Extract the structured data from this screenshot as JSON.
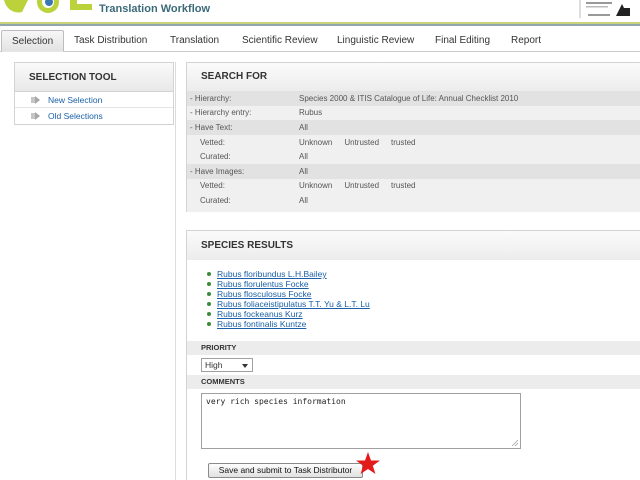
{
  "header": {
    "app_title": "Translation Workflow",
    "logo_icon": "col-logo-icon",
    "partner_logo_icon": "bibliotheca-alexandrina-logo-icon"
  },
  "tabs": [
    {
      "label": "Selection",
      "active": true
    },
    {
      "label": "Task Distribution",
      "active": false
    },
    {
      "label": "Translation",
      "active": false
    },
    {
      "label": "Scientific Review",
      "active": false
    },
    {
      "label": "Linguistic Review",
      "active": false
    },
    {
      "label": "Final Editing",
      "active": false
    },
    {
      "label": "Report",
      "active": false
    }
  ],
  "selection_tool": {
    "title": "SELECTION TOOL",
    "items": [
      {
        "label": "New Selection",
        "icon": "arrow-bullet-icon"
      },
      {
        "label": "Old Selections",
        "icon": "arrow-bullet-icon"
      }
    ]
  },
  "search_for": {
    "title": "SEARCH FOR",
    "hierarchy": {
      "label": "- Hierarchy:",
      "value": "Species 2000 & ITIS Catalogue of Life: Annual Checklist 2010"
    },
    "hierarchy_entry": {
      "label": "- Hierarchy entry:",
      "value": "Rubus"
    },
    "have_text": {
      "label": "- Have Text:",
      "value": "All"
    },
    "text_vetted": {
      "label": "Vetted:",
      "options": [
        "Unknown",
        "Untrusted",
        "trusted"
      ]
    },
    "text_curated": {
      "label": "Curated:",
      "value": "All"
    },
    "have_images": {
      "label": "- Have Images:",
      "value": "All"
    },
    "images_vetted": {
      "label": "Vetted:",
      "options": [
        "Unknown",
        "Untrusted",
        "trusted"
      ]
    },
    "images_curated": {
      "label": "Curated:",
      "value": "All"
    }
  },
  "species_results": {
    "title": "SPECIES RESULTS",
    "species": [
      "Rubus floribundus L.H.Bailey",
      "Rubus florulentus Focke",
      "Rubus flosculosus Focke",
      "Rubus foliaceistipulatus T.T. Yu & L.T. Lu",
      "Rubus fockeanus Kurz",
      "Rubus fontinalis Kuntze"
    ],
    "priority_label": "PRIORITY",
    "priority_value": "High",
    "comments_label": "COMMENTS",
    "comments_value": "very rich species information",
    "submit_label": "Save and submit to Task Distributor",
    "star_icon": "red-star-icon"
  },
  "colors": {
    "link": "#1a5fa8",
    "header_accent": "#c9d47a",
    "star": "#e31b1b"
  }
}
